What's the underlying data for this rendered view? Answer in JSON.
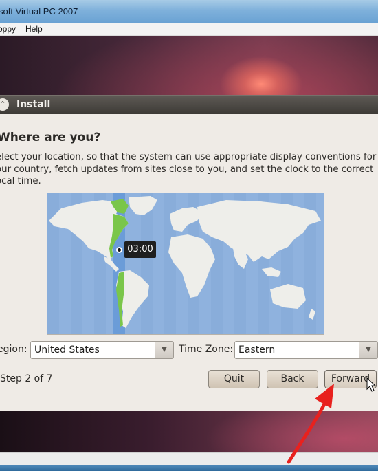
{
  "window": {
    "title": "soft Virtual PC 2007"
  },
  "menu": {
    "items": [
      "oppy",
      "Help"
    ]
  },
  "installer": {
    "header": "Install",
    "heading": "Where are you?",
    "description": [
      "elect your location, so that the system can use appropriate display conventions for",
      "our country, fetch updates from sites close to you, and set the clock to the correct",
      "ocal time."
    ],
    "map": {
      "time_label": "03:00"
    },
    "region_label": "egion:",
    "region_value": "United States",
    "timezone_label": "Time Zone:",
    "timezone_value": "Eastern",
    "step_text": "Step 2 of 7",
    "quit_label": "Quit",
    "back_label": "Back",
    "forward_label": "Forward"
  },
  "colors": {
    "panel": "#efebe6",
    "header_bar": "#3d3a36",
    "timezone_highlight": "#7aa7d8",
    "selected_land": "#7ac64a",
    "ocean": "#8fb2de",
    "annotation_arrow": "#e8211e"
  }
}
